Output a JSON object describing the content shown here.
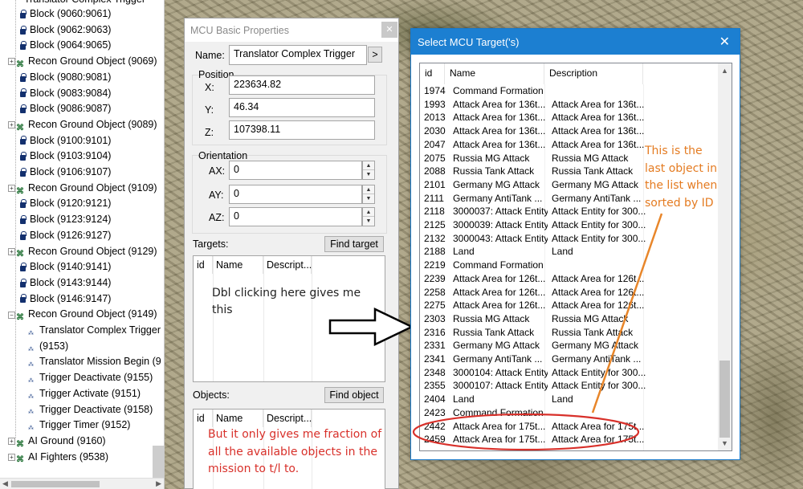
{
  "tree": {
    "partial_top": "Translator Complex Trigger",
    "items": [
      {
        "label": "Block (9060:9061)",
        "icon": "block-icon",
        "indent": 1
      },
      {
        "label": "Block (9062:9063)",
        "icon": "block-icon",
        "indent": 1
      },
      {
        "label": "Block (9064:9065)",
        "icon": "block-icon",
        "indent": 1
      },
      {
        "label": "Recon Ground Object (9069)",
        "icon": "recon-icon",
        "indent": 0,
        "expander": "+"
      },
      {
        "label": "Block (9080:9081)",
        "icon": "block-icon",
        "indent": 1
      },
      {
        "label": "Block (9083:9084)",
        "icon": "block-icon",
        "indent": 1
      },
      {
        "label": "Block (9086:9087)",
        "icon": "block-icon",
        "indent": 1
      },
      {
        "label": "Recon Ground Object (9089)",
        "icon": "recon-icon",
        "indent": 0,
        "expander": "+"
      },
      {
        "label": "Block (9100:9101)",
        "icon": "block-icon",
        "indent": 1
      },
      {
        "label": "Block (9103:9104)",
        "icon": "block-icon",
        "indent": 1
      },
      {
        "label": "Block (9106:9107)",
        "icon": "block-icon",
        "indent": 1
      },
      {
        "label": "Recon Ground Object (9109)",
        "icon": "recon-icon",
        "indent": 0,
        "expander": "+"
      },
      {
        "label": "Block (9120:9121)",
        "icon": "block-icon",
        "indent": 1
      },
      {
        "label": "Block (9123:9124)",
        "icon": "block-icon",
        "indent": 1
      },
      {
        "label": "Block (9126:9127)",
        "icon": "block-icon",
        "indent": 1
      },
      {
        "label": "Recon Ground Object (9129)",
        "icon": "recon-icon",
        "indent": 0,
        "expander": "+"
      },
      {
        "label": "Block (9140:9141)",
        "icon": "block-icon",
        "indent": 1
      },
      {
        "label": "Block (9143:9144)",
        "icon": "block-icon",
        "indent": 1
      },
      {
        "label": "Block (9146:9147)",
        "icon": "block-icon",
        "indent": 1
      },
      {
        "label": "Recon Ground Object (9149)",
        "icon": "recon-icon",
        "indent": 0,
        "expander": "−"
      },
      {
        "label": "Translator Complex Trigger",
        "icon": "translator-icon",
        "indent": 2
      },
      {
        "label": "(9153)",
        "icon": "ico-icon",
        "indent": 2
      },
      {
        "label": "Translator Mission Begin (9",
        "icon": "mission-begin-icon",
        "indent": 2
      },
      {
        "label": "Trigger Deactivate (9155)",
        "icon": "deactivate-icon",
        "indent": 2
      },
      {
        "label": "Trigger Activate (9151)",
        "icon": "activate-icon",
        "indent": 2
      },
      {
        "label": "Trigger Deactivate (9158)",
        "icon": "deactivate-icon",
        "indent": 2
      },
      {
        "label": "Trigger Timer (9152)",
        "icon": "timer-icon",
        "indent": 2
      },
      {
        "label": "AI Ground (9160)",
        "icon": "recon-icon",
        "indent": 0,
        "expander": "+"
      },
      {
        "label": "AI Fighters (9538)",
        "icon": "recon-icon",
        "indent": 0,
        "expander": "+"
      }
    ]
  },
  "props": {
    "title": "MCU Basic Properties",
    "name_label": "Name:",
    "name_value": "Translator Complex Trigger",
    "name_btn": ">",
    "position_label": "Position",
    "x_label": "X:",
    "x_value": "223634.82",
    "y_label": "Y:",
    "y_value": "46.34",
    "z_label": "Z:",
    "z_value": "107398.11",
    "orientation_label": "Orientation",
    "ax_label": "AX:",
    "ax_value": "0",
    "ay_label": "AY:",
    "ay_value": "0",
    "az_label": "AZ:",
    "az_value": "0",
    "targets_label": "Targets:",
    "find_target": "Find target",
    "objects_label": "Objects:",
    "find_object": "Find object",
    "col_id": "id",
    "col_name": "Name",
    "col_desc": "Descript..."
  },
  "annotations": {
    "dbl_click": [
      "Dbl clicking here gives me",
      "this"
    ],
    "fraction": [
      "But it only gives me fraction of",
      "all the available objects in the",
      "mission to t/l to."
    ],
    "last_object": [
      "This is the",
      "last object in",
      "the list when",
      "sorted by ID"
    ]
  },
  "dialog": {
    "title": "Select MCU Target('s)",
    "close": "✕",
    "columns": [
      "id",
      "Name",
      "Description"
    ],
    "rows": [
      [
        "1974",
        "Command Formation",
        ""
      ],
      [
        "1993",
        "Attack Area for 136t...",
        "Attack Area for 136t..."
      ],
      [
        "2013",
        "Attack Area for 136t...",
        "Attack Area for 136t..."
      ],
      [
        "2030",
        "Attack Area for 136t...",
        "Attack Area for 136t..."
      ],
      [
        "2047",
        "Attack Area for 136t...",
        "Attack Area for 136t..."
      ],
      [
        "2075",
        "Russia MG Attack",
        "Russia MG Attack"
      ],
      [
        "2088",
        "Russia Tank Attack",
        "Russia Tank Attack"
      ],
      [
        "2101",
        "Germany MG Attack",
        "Germany MG Attack"
      ],
      [
        "2111",
        "Germany AntiTank ...",
        "Germany AntiTank ..."
      ],
      [
        "2118",
        "3000037: Attack Entity",
        "Attack Entity for 300..."
      ],
      [
        "2125",
        "3000039: Attack Entity",
        "Attack Entity for 300..."
      ],
      [
        "2132",
        "3000043: Attack Entity",
        "Attack Entity for 300..."
      ],
      [
        "2188",
        "Land",
        "Land"
      ],
      [
        "2219",
        "Command Formation",
        ""
      ],
      [
        "2239",
        "Attack Area for 126t...",
        "Attack Area for 126t..."
      ],
      [
        "2258",
        "Attack Area for 126t...",
        "Attack Area for 126t..."
      ],
      [
        "2275",
        "Attack Area for 126t...",
        "Attack Area for 126t..."
      ],
      [
        "2303",
        "Russia MG Attack",
        "Russia MG Attack"
      ],
      [
        "2316",
        "Russia Tank Attack",
        "Russia Tank Attack"
      ],
      [
        "2331",
        "Germany MG Attack",
        "Germany MG Attack"
      ],
      [
        "2341",
        "Germany AntiTank ...",
        "Germany AntiTank ..."
      ],
      [
        "2348",
        "3000104: Attack Entity",
        "Attack Entity for 300..."
      ],
      [
        "2355",
        "3000107: Attack Entity",
        "Attack Entity for 300..."
      ],
      [
        "2404",
        "Land",
        "Land"
      ],
      [
        "2423",
        "Command Formation",
        ""
      ],
      [
        "2442",
        "Attack Area for 175t...",
        "Attack Area for 175t..."
      ],
      [
        "2459",
        "Attack Area for 175t...",
        "Attack Area for 175t..."
      ]
    ]
  },
  "colors": {
    "title_blue": "#1c7fd1",
    "annotation_red": "#d8302a",
    "annotation_orange": "#e47b21"
  }
}
